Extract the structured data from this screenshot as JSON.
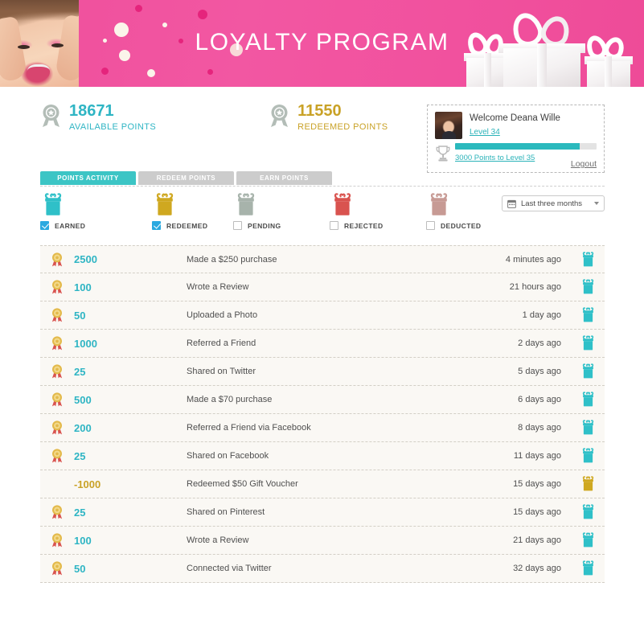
{
  "banner": {
    "title": "LOYALTY PROGRAM",
    "bg_color": "#f0549c",
    "model_alt": "model-photo",
    "gifts_alt": "gift-boxes"
  },
  "summary": {
    "stats": [
      {
        "value": "18671",
        "label": "AVAILABLE POINTS",
        "color": "#2fb5c4",
        "icon": "ribbon-award-icon"
      },
      {
        "value": "11550",
        "label": "REDEEMED POINTS",
        "color": "#c9a227",
        "icon": "ribbon-award-icon"
      }
    ]
  },
  "user_panel": {
    "welcome": "Welcome Deana Wille",
    "level_link": "Level 34",
    "progress_link": "3000 Points to Level 35",
    "progress_percent": 88,
    "logout": "Logout",
    "avatar_icon": "avatar",
    "trophy_icon": "trophy-icon",
    "accent_color": "#2bb9bd"
  },
  "tabs": [
    {
      "label": "POINTS ACTIVITY",
      "active": true
    },
    {
      "label": "REDEEM POINTS",
      "active": false
    },
    {
      "label": "EARN POINTS",
      "active": false
    }
  ],
  "filters": [
    {
      "label": "EARNED",
      "checked": true,
      "color": "#2fc0c8",
      "icon": "gift-icon"
    },
    {
      "label": "REDEEMED",
      "checked": true,
      "color": "#cfa820",
      "icon": "gift-icon"
    },
    {
      "label": "PENDING",
      "checked": false,
      "color": "#a7b3ab",
      "icon": "gift-icon"
    },
    {
      "label": "REJECTED",
      "checked": false,
      "color": "#d9534f",
      "icon": "gift-icon"
    },
    {
      "label": "DEDUCTED",
      "checked": false,
      "color": "#c79a94",
      "icon": "gift-icon"
    }
  ],
  "date_filter": {
    "selected": "Last three months",
    "icon": "calendar-icon",
    "caret": "chevron-down-icon"
  },
  "activity": {
    "rows": [
      {
        "points": "2500",
        "type": "earned",
        "description": "Made a $250 purchase",
        "time": "4 minutes ago",
        "has_medal": true,
        "gift_color": "#2fc0c8"
      },
      {
        "points": "100",
        "type": "earned",
        "description": "Wrote a Review",
        "time": "21 hours ago",
        "has_medal": true,
        "gift_color": "#2fc0c8"
      },
      {
        "points": "50",
        "type": "earned",
        "description": "Uploaded a Photo",
        "time": "1 day ago",
        "has_medal": true,
        "gift_color": "#2fc0c8"
      },
      {
        "points": "1000",
        "type": "earned",
        "description": "Referred a Friend",
        "time": "2 days ago",
        "has_medal": true,
        "gift_color": "#2fc0c8"
      },
      {
        "points": "25",
        "type": "earned",
        "description": "Shared on Twitter",
        "time": "5 days ago",
        "has_medal": true,
        "gift_color": "#2fc0c8"
      },
      {
        "points": "500",
        "type": "earned",
        "description": "Made a $70 purchase",
        "time": "6 days ago",
        "has_medal": true,
        "gift_color": "#2fc0c8"
      },
      {
        "points": "200",
        "type": "earned",
        "description": "Referred a Friend via Facebook",
        "time": "8 days ago",
        "has_medal": true,
        "gift_color": "#2fc0c8"
      },
      {
        "points": "25",
        "type": "earned",
        "description": "Shared on Facebook",
        "time": "11 days ago",
        "has_medal": true,
        "gift_color": "#2fc0c8"
      },
      {
        "points": "-1000",
        "type": "redeemed",
        "description": "Redeemed $50 Gift Voucher",
        "time": "15 days ago",
        "has_medal": false,
        "gift_color": "#cfa820"
      },
      {
        "points": "25",
        "type": "earned",
        "description": "Shared on Pinterest",
        "time": "15 days ago",
        "has_medal": true,
        "gift_color": "#2fc0c8"
      },
      {
        "points": "100",
        "type": "earned",
        "description": "Wrote a Review",
        "time": "21 days ago",
        "has_medal": true,
        "gift_color": "#2fc0c8"
      },
      {
        "points": "50",
        "type": "earned",
        "description": "Connected via Twitter",
        "time": "32 days ago",
        "has_medal": true,
        "gift_color": "#2fc0c8"
      }
    ]
  }
}
